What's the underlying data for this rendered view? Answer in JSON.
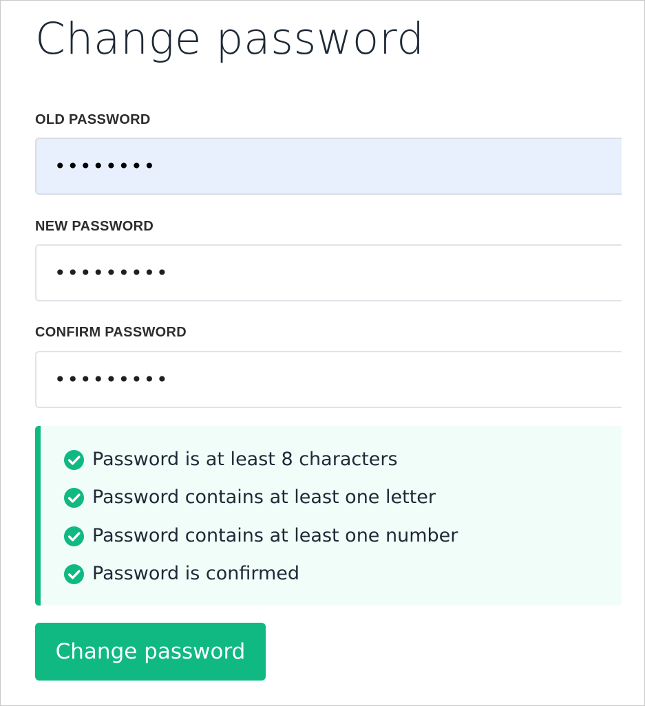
{
  "page": {
    "title": "Change password"
  },
  "form": {
    "old_password": {
      "label": "OLD PASSWORD",
      "value": "••••••••",
      "autofilled": true
    },
    "new_password": {
      "label": "NEW PASSWORD",
      "value": "•••••••••"
    },
    "confirm_password": {
      "label": "CONFIRM PASSWORD",
      "value": "•••••••••"
    }
  },
  "requirements": [
    {
      "text": "Password is at least 8 characters",
      "met": true,
      "icon": "check-circle-icon"
    },
    {
      "text": "Password contains at least one letter",
      "met": true,
      "icon": "check-circle-icon"
    },
    {
      "text": "Password contains at least one number",
      "met": true,
      "icon": "check-circle-icon"
    },
    {
      "text": "Password is confirmed",
      "met": true,
      "icon": "check-circle-icon"
    }
  ],
  "submit": {
    "label": "Change password"
  },
  "colors": {
    "accent": "#10b981",
    "requirements_bg": "#f0fdf8",
    "autofill_bg": "#e8f0fe",
    "text": "#1f2937"
  }
}
